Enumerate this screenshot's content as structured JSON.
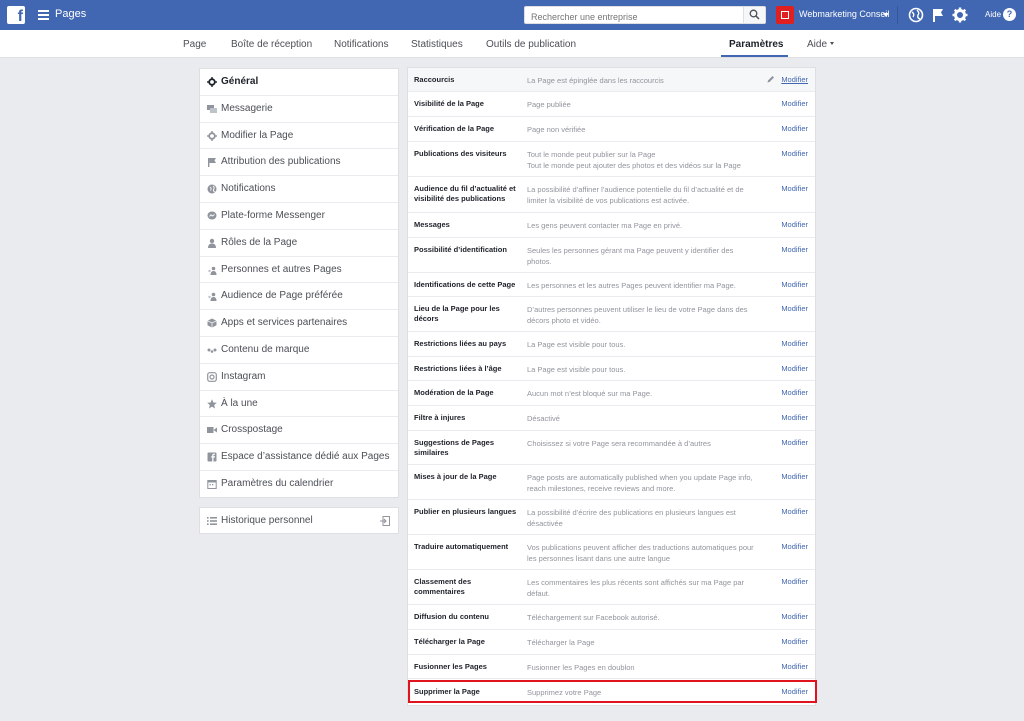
{
  "topbar": {
    "logo_letter": "f",
    "title": "Pages",
    "search_placeholder": "Rechercher une entreprise",
    "page_name": "Webmarketing Conseil",
    "help_label": "Aide",
    "help_glyph": "?"
  },
  "nav": {
    "items": [
      "Page",
      "Boîte de réception",
      "Notifications",
      "Statistiques",
      "Outils de publication"
    ],
    "active": "Paramètres",
    "help": "Aide"
  },
  "sidebar": {
    "items": [
      {
        "label": "Général",
        "icon": "gear-icon"
      },
      {
        "label": "Messagerie",
        "icon": "chat-icon"
      },
      {
        "label": "Modifier la Page",
        "icon": "gear-icon"
      },
      {
        "label": "Attribution des publications",
        "icon": "flag-icon"
      },
      {
        "label": "Notifications",
        "icon": "globe-icon"
      },
      {
        "label": "Plate-forme Messenger",
        "icon": "messenger-icon"
      },
      {
        "label": "Rôles de la Page",
        "icon": "person-icon"
      },
      {
        "label": "Personnes et autres Pages",
        "icon": "people-icon"
      },
      {
        "label": "Audience de Page préférée",
        "icon": "people-icon"
      },
      {
        "label": "Apps et services partenaires",
        "icon": "cube-icon"
      },
      {
        "label": "Contenu de marque",
        "icon": "handshake-icon"
      },
      {
        "label": "Instagram",
        "icon": "instagram-icon"
      },
      {
        "label": "À la une",
        "icon": "star-icon"
      },
      {
        "label": "Crosspostage",
        "icon": "video-icon"
      },
      {
        "label": "Espace d’assistance dédié aux Pages",
        "icon": "facebook-icon"
      },
      {
        "label": "Paramètres du calendrier",
        "icon": "calendar-icon"
      }
    ],
    "history": {
      "label": "Historique personnel",
      "icon": "list-icon"
    }
  },
  "settings": {
    "edit_label": "Modifier",
    "rows": [
      {
        "label": "Raccourcis",
        "value": "La Page est épinglée dans les raccourcis"
      },
      {
        "label": "Visibilité de la Page",
        "value": "Page publiée"
      },
      {
        "label": "Vérification de la Page",
        "value": "Page non vérifiée"
      },
      {
        "label": "Publications des visiteurs",
        "value": "Tout le monde peut publier sur la Page\nTout le monde peut ajouter des photos et des vidéos sur la Page"
      },
      {
        "label": "Audience du fil d’actualité et visibilité des publications",
        "value": "La possibilité d’affiner l’audience potentielle du fil d’actualité et de limiter la visibilité de vos publications est activée."
      },
      {
        "label": "Messages",
        "value": "Les gens peuvent contacter ma Page en privé."
      },
      {
        "label": "Possibilité d’identification",
        "value": "Seules les personnes gérant ma Page peuvent y identifier des photos."
      },
      {
        "label": "Identifications de cette Page",
        "value": "Les personnes et les autres Pages peuvent identifier ma Page."
      },
      {
        "label": "Lieu de la Page pour les décors",
        "value": "D’autres personnes peuvent utiliser le lieu de votre Page dans des décors photo et vidéo."
      },
      {
        "label": "Restrictions liées au pays",
        "value": "La Page est visible pour tous."
      },
      {
        "label": "Restrictions liées à l’âge",
        "value": "La Page est visible pour tous."
      },
      {
        "label": "Modération de la Page",
        "value": "Aucun mot n’est bloqué sur ma Page."
      },
      {
        "label": "Filtre à injures",
        "value": "Désactivé"
      },
      {
        "label": "Suggestions de Pages similaires",
        "value": "Choisissez si votre Page sera recommandée à d’autres"
      },
      {
        "label": "Mises à jour de la Page",
        "value": "Page posts are automatically published when you update Page info, reach milestones, receive reviews and more."
      },
      {
        "label": "Publier en plusieurs langues",
        "value": "La possibilité d’écrire des publications en plusieurs langues est désactivée"
      },
      {
        "label": "Traduire automatiquement",
        "value": "Vos publications peuvent afficher des traductions automatiques pour les personnes lisant dans une autre langue"
      },
      {
        "label": "Classement des commentaires",
        "value": "Les commentaires les plus récents sont affichés sur ma Page par défaut."
      },
      {
        "label": "Diffusion du contenu",
        "value": "Téléchargement sur Facebook autorisé."
      },
      {
        "label": "Télécharger la Page",
        "value": "Télécharger la Page"
      },
      {
        "label": "Fusionner les Pages",
        "value": "Fusionner les Pages en doublon"
      },
      {
        "label": "Supprimer la Page",
        "value": "Supprimez votre Page"
      }
    ]
  },
  "colors": {
    "brand": "#4267b2",
    "link": "#4267b2",
    "highlight": "#e0141e",
    "page_badge": "#e02020"
  }
}
